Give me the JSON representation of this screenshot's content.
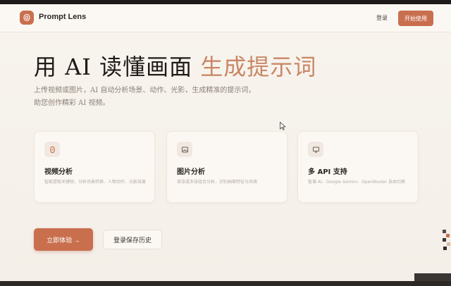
{
  "header": {
    "brand": "Prompt Lens",
    "login": "登录",
    "start": "开始使用"
  },
  "hero": {
    "title_main": "用 AI 读懂画面 ",
    "title_accent": "生成提示词",
    "subtitle": "上传视频或图片，AI 自动分析场景、动作、光影，生成精准的提示词，助您创作精彩 AI 视频。"
  },
  "features": [
    {
      "icon": "video-icon",
      "title": "视频分析",
      "desc": "智能提取关键帧，分析场景转换、人物动作、光影效果"
    },
    {
      "icon": "image-icon",
      "title": "图片分析",
      "desc": "单张或多张组合分析，识别画面特征与风格"
    },
    {
      "icon": "monitor-icon",
      "title": "多 API 支持",
      "desc": "智谱 AI、Google Gemini、OpenRouter 自由切换"
    }
  ],
  "actions": {
    "primary": "立即体验 →",
    "secondary": "登录保存历史"
  },
  "colors": {
    "accent": "#c96f4e",
    "accent_light": "#c98766",
    "background": "#f6f1ea"
  }
}
